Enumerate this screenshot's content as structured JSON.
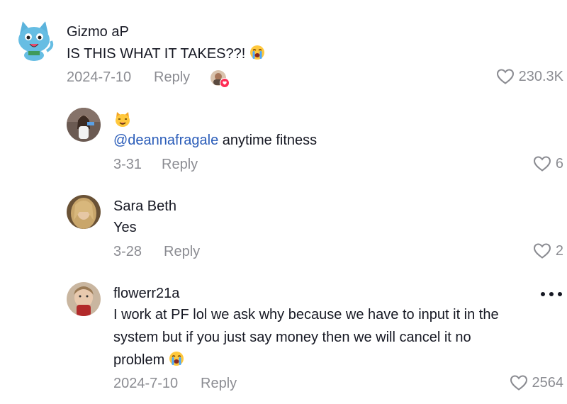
{
  "comments": [
    {
      "author": "Gizmo aP",
      "text": "IS THIS WHAT IT TAKES??!",
      "text_emoji": "crying-face-emoji",
      "date": "2024-7-10",
      "reply_label": "Reply",
      "likes": "230.3K"
    },
    {
      "author_emoji": "cat-face-emoji",
      "mention": "@deannafragale",
      "text": " anytime fitness",
      "date": "3-31",
      "reply_label": "Reply",
      "likes": "6"
    },
    {
      "author": "Sara Beth",
      "text": "Yes",
      "date": "3-28",
      "reply_label": "Reply",
      "likes": "2"
    },
    {
      "author": "flowerr21a",
      "text_lines": [
        "I work at PF lol we ask why because we have to input it in the",
        "system but if you just say money then we will cancel it no",
        "problem"
      ],
      "text_emoji": "crying-face-emoji",
      "date": "2024-7-10",
      "reply_label": "Reply",
      "likes": "2564"
    }
  ],
  "colors": {
    "text": "#161823",
    "muted": "#8a8b91",
    "mention": "#2b5db9",
    "creator_liked_badge": "#fe2c55"
  }
}
